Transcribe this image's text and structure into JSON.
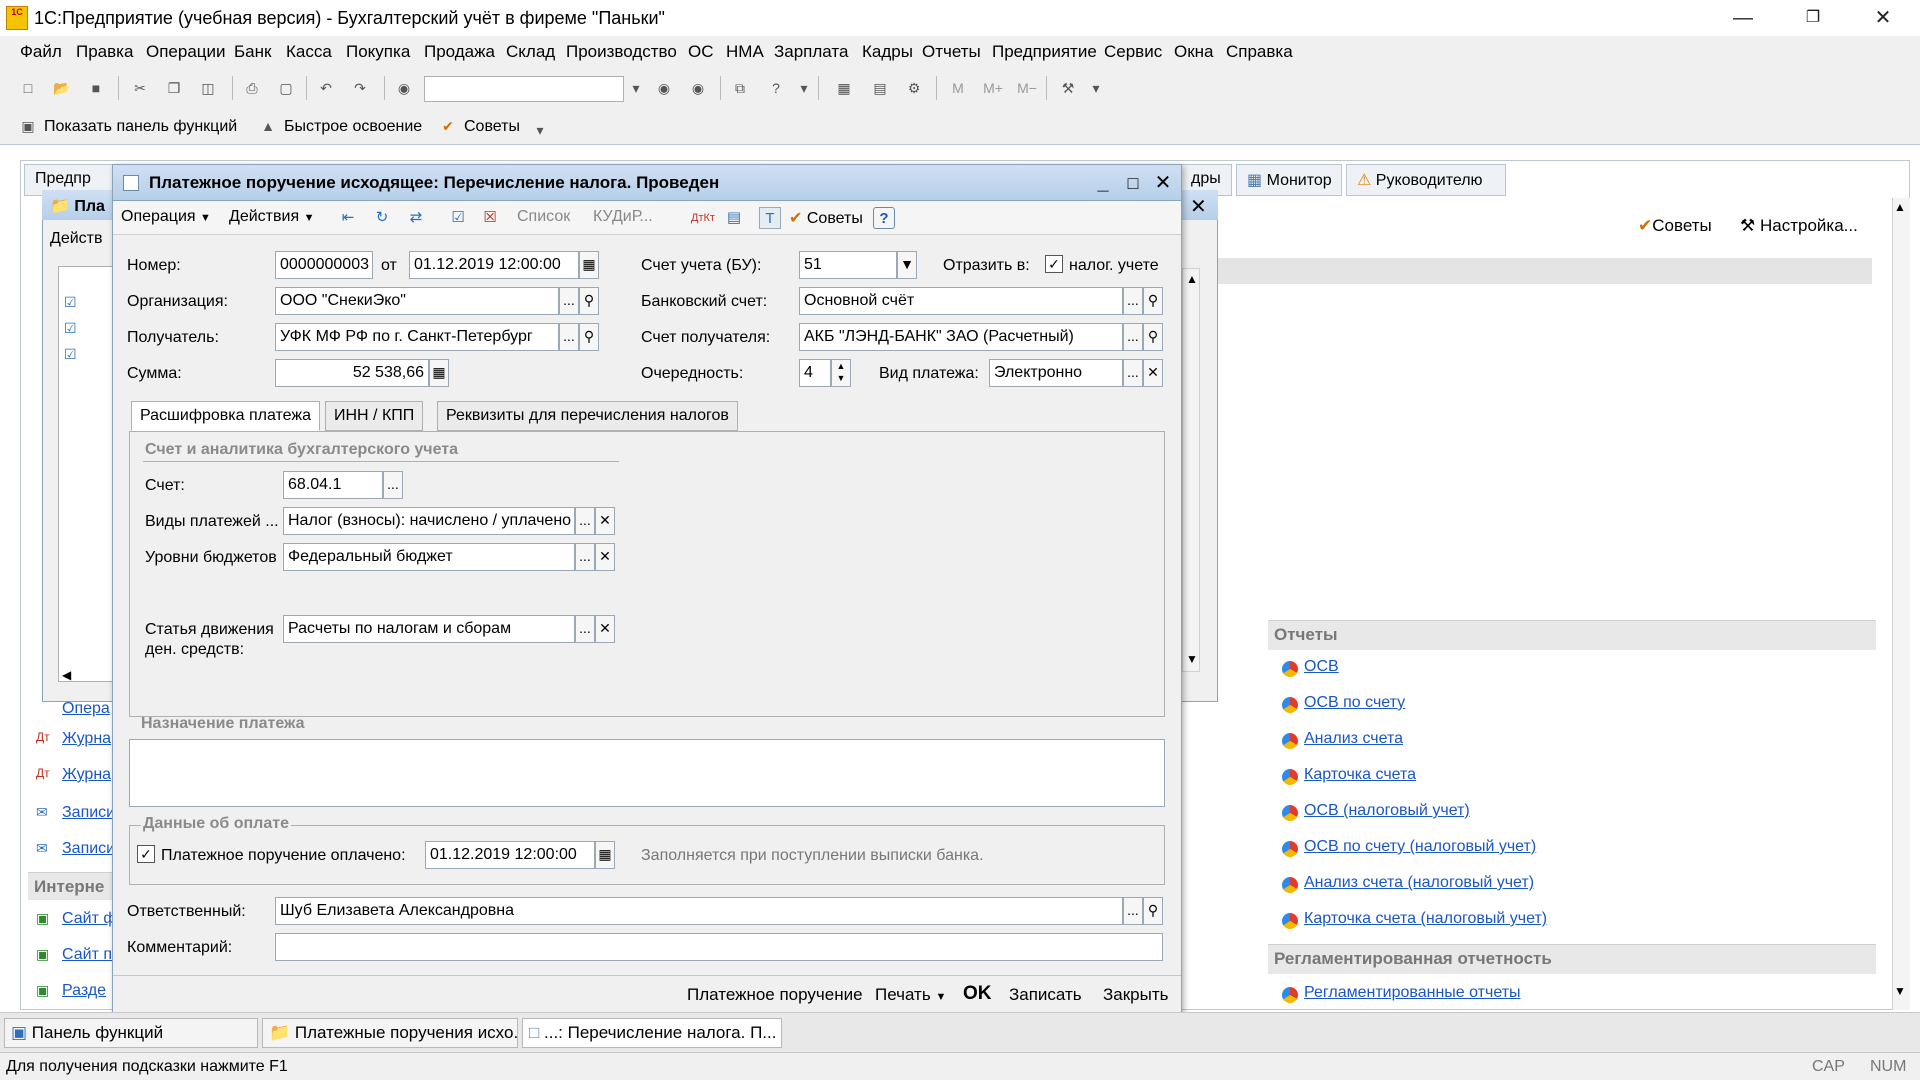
{
  "app": {
    "logo_text": "1C",
    "title": "1С:Предприятие (учебная версия) - Бухгалтерский учёт в фиреме \"Паньки\""
  },
  "menu": [
    "Файл",
    "Правка",
    "Операции",
    "Банк",
    "Касса",
    "Покупка",
    "Продажа",
    "Склад",
    "Производство",
    "ОС",
    "НМА",
    "Зарплата",
    "Кадры",
    "Отчеты",
    "Предприятие",
    "Сервис",
    "Окна",
    "Справка"
  ],
  "toolbar2": {
    "show_panel": "Показать панель функций",
    "quick_start": "Быстрое освоение",
    "tips": "Советы"
  },
  "bg_window": {
    "tab_predpr": "Предпр",
    "tab_kadry": "дры",
    "tab_monitor": "Монитор",
    "tab_manager": "Руководителю",
    "tips": "Советы",
    "settings": "Настройка...",
    "child_title": "Пла",
    "child_actions": "Действ",
    "left_links": [
      "Опера",
      "Журна",
      "Журна",
      "Записи",
      "Записи"
    ],
    "left_section": "Интерне",
    "left_links2": [
      "Сайт ф",
      "Сайт п",
      "Разде"
    ]
  },
  "reports": {
    "title": "Отчеты",
    "items": [
      "ОСВ",
      "ОСВ по счету",
      "Анализ счета",
      "Карточка счета",
      "ОСВ (налоговый учет)",
      "ОСВ по счету (налоговый учет)",
      "Анализ счета (налоговый учет)",
      "Карточка счета (налоговый учет)"
    ],
    "reg_title": "Регламентированная отчетность",
    "reg_items": [
      "Регламентированные отчеты"
    ]
  },
  "dialog": {
    "title": "Платежное поручение исходящее: Перечисление налога. Проведен",
    "toolbar": {
      "operation": "Операция",
      "actions": "Действия",
      "list": "Список",
      "kudir": "КУДиР...",
      "tips": "Советы",
      "help": "?"
    },
    "fields": {
      "number_label": "Номер:",
      "number": "0000000003",
      "from_label": "от",
      "date": "01.12.2019 12:00:00",
      "account_bu_label": "Счет учета (БУ):",
      "account_bu": "51",
      "reflect_label": "Отразить в:",
      "reflect_tax": "налог. учете",
      "org_label": "Организация:",
      "org": "ООО \"СнекиЭко\"",
      "bank_account_label": "Банковский счет:",
      "bank_account": "Основной счёт",
      "recipient_label": "Получатель:",
      "recipient": "УФК МФ РФ по г. Санкт-Петербург",
      "recipient_account_label": "Счет получателя:",
      "recipient_account": "АКБ \"ЛЭНД-БАНК\" ЗАО (Расчетный)",
      "sum_label": "Сумма:",
      "sum": "52 538,66",
      "priority_label": "Очередность:",
      "priority": "4",
      "payment_type_label": "Вид платежа:",
      "payment_type": "Электронно"
    },
    "tabs": [
      "Расшифровка платежа",
      "ИНН / КПП",
      "Реквизиты для перечисления налогов"
    ],
    "analytics": {
      "title": "Счет и аналитика бухгалтерского учета",
      "account_label": "Счет:",
      "account": "68.04.1",
      "payment_kinds_label": "Виды платежей ...",
      "payment_kinds": "Налог (взносы): начислено / уплачено",
      "budget_level_label": "Уровни бюджетов",
      "budget_level": "Федеральный бюджет",
      "cashflow_label_1": "Статья движения",
      "cashflow_label_2": "ден. средств:",
      "cashflow": "Расчеты по налогам и сборам"
    },
    "purpose": {
      "title": "Назначение платежа",
      "text": ""
    },
    "payment": {
      "title": "Данные об оплате",
      "paid_label": "Платежное поручение оплачено:",
      "paid_date": "01.12.2019 12:00:00",
      "hint": "Заполняется при поступлении выписки банка."
    },
    "responsible_label": "Ответственный:",
    "responsible": "Шуб Елизавета Александровна",
    "comment_label": "Комментарий:",
    "comment": "",
    "buttons": {
      "print_form": "Платежное поручение",
      "print": "Печать",
      "ok": "OK",
      "save": "Записать",
      "close": "Закрыть"
    }
  },
  "taskbar": [
    "Панель функций",
    "Платежные поручения исхо...",
    "...: Перечисление налога. П..."
  ],
  "status": {
    "hint": "Для получения подсказки нажмите F1",
    "cap": "CAP",
    "num": "NUM"
  }
}
